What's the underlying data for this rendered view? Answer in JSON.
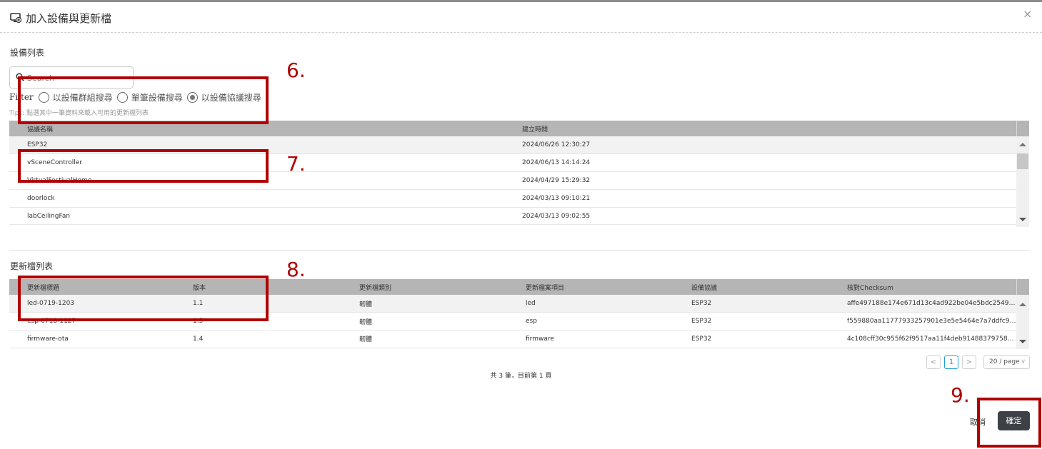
{
  "dialog": {
    "title": "加入設備與更新檔",
    "close": "×"
  },
  "devices": {
    "section_title": "設備列表",
    "search_placeholder": "Search",
    "filter_label": "Filter",
    "filter_options": [
      "以設備群組搜尋",
      "單筆設備搜尋",
      "以設備協議搜尋"
    ],
    "filter_selected_index": 2,
    "tips": "Tips: 點選其中一筆資料來載入可用的更新檔列表",
    "columns": [
      "協議名稱",
      "建立時間"
    ],
    "rows": [
      [
        "ESP32",
        "2024/06/26 12:30:27"
      ],
      [
        "vSceneController",
        "2024/06/13 14:14:24"
      ],
      [
        "VirtualFestivalHome",
        "2024/04/29 15:29:32"
      ],
      [
        "doorlock",
        "2024/03/13 09:10:21"
      ],
      [
        "labCeilingFan",
        "2024/03/13 09:02:55"
      ]
    ]
  },
  "updates": {
    "section_title": "更新檔列表",
    "columns": [
      "更新檔標題",
      "版本",
      "更新檔類別",
      "更新檔案項目",
      "設備協議",
      "核對Checksum"
    ],
    "rows": [
      [
        "led-0719-1203",
        "1.1",
        "韌體",
        "led",
        "ESP32",
        "affe497188e174e671d13c4ad922be04e5bdc25492c21..."
      ],
      [
        "esp-0718-1127",
        "1.5",
        "韌體",
        "esp",
        "ESP32",
        "f559880aa11777933257901e3e5e5464e7a7ddfc991a5..."
      ],
      [
        "firmware-ota",
        "1.4",
        "韌體",
        "firmware",
        "ESP32",
        "4c108cff30c955f62f9517aa11f4deb9148837975872ad3..."
      ]
    ]
  },
  "pagination": {
    "prev": "<",
    "current_page": "1",
    "next": ">",
    "page_size": "20 / page",
    "info": "共 3 筆，目前第 1 頁"
  },
  "footer": {
    "cancel_label": "取消",
    "confirm_label": "確定"
  },
  "annotations": [
    "6.",
    "7.",
    "8.",
    "9."
  ],
  "colors": {
    "annotation": "#b20000",
    "header_bg": "#b5b5b5",
    "confirm_bg": "#3c4148",
    "active_page": "#1e9fd6"
  },
  "icons": {
    "dialog": "device-add-icon",
    "search": "search-icon",
    "close": "close-icon"
  }
}
